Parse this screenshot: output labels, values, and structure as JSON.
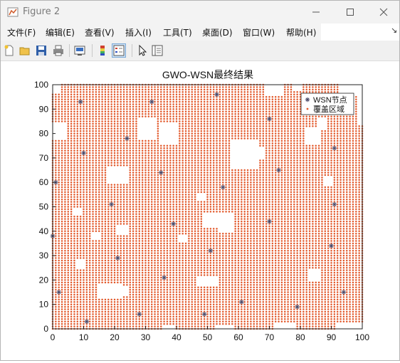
{
  "window": {
    "title": "Figure 2"
  },
  "menu": [
    "文件(F)",
    "编辑(E)",
    "查看(V)",
    "插入(I)",
    "工具(T)",
    "桌面(D)",
    "窗口(W)",
    "帮助(H)"
  ],
  "toolbar_icons": [
    "new-figure-icon",
    "open-file-icon",
    "save-icon",
    "print-icon",
    "link-plot-icon",
    "insert-colorbar-icon",
    "insert-legend-icon",
    "edit-plot-icon",
    "property-inspector-icon"
  ],
  "chart_data": {
    "type": "scatter",
    "title": "GWO-WSN最终结果",
    "xlabel": "",
    "ylabel": "",
    "xlim": [
      0,
      100
    ],
    "ylim": [
      0,
      100
    ],
    "xticks": [
      0,
      10,
      20,
      30,
      40,
      50,
      60,
      70,
      80,
      90,
      100
    ],
    "yticks": [
      0,
      10,
      20,
      30,
      40,
      50,
      60,
      70,
      80,
      90,
      100
    ],
    "grid": false,
    "legend_position": "top-right",
    "colors": {
      "nodes": "#4a4a6a",
      "coverage": "#e2582a"
    },
    "series": [
      {
        "name": "WSN节点",
        "marker": "asterisk",
        "x": [
          9,
          32,
          53,
          24,
          70,
          91,
          10,
          73,
          35,
          1,
          55,
          19,
          91,
          0,
          70,
          39,
          51,
          21,
          90,
          36,
          2,
          94,
          61,
          28,
          49,
          11,
          79
        ],
        "y": [
          93,
          93,
          96,
          78,
          86,
          74,
          72,
          65,
          64,
          60,
          58,
          51,
          51,
          38,
          44,
          43,
          32,
          29,
          34,
          21,
          15,
          15,
          11,
          6,
          6,
          3,
          9
        ]
      },
      {
        "name": "覆盖区域",
        "marker": "dot",
        "grid_step": 1,
        "x_range": [
          0,
          100
        ],
        "y_range": [
          0,
          100
        ]
      }
    ]
  }
}
